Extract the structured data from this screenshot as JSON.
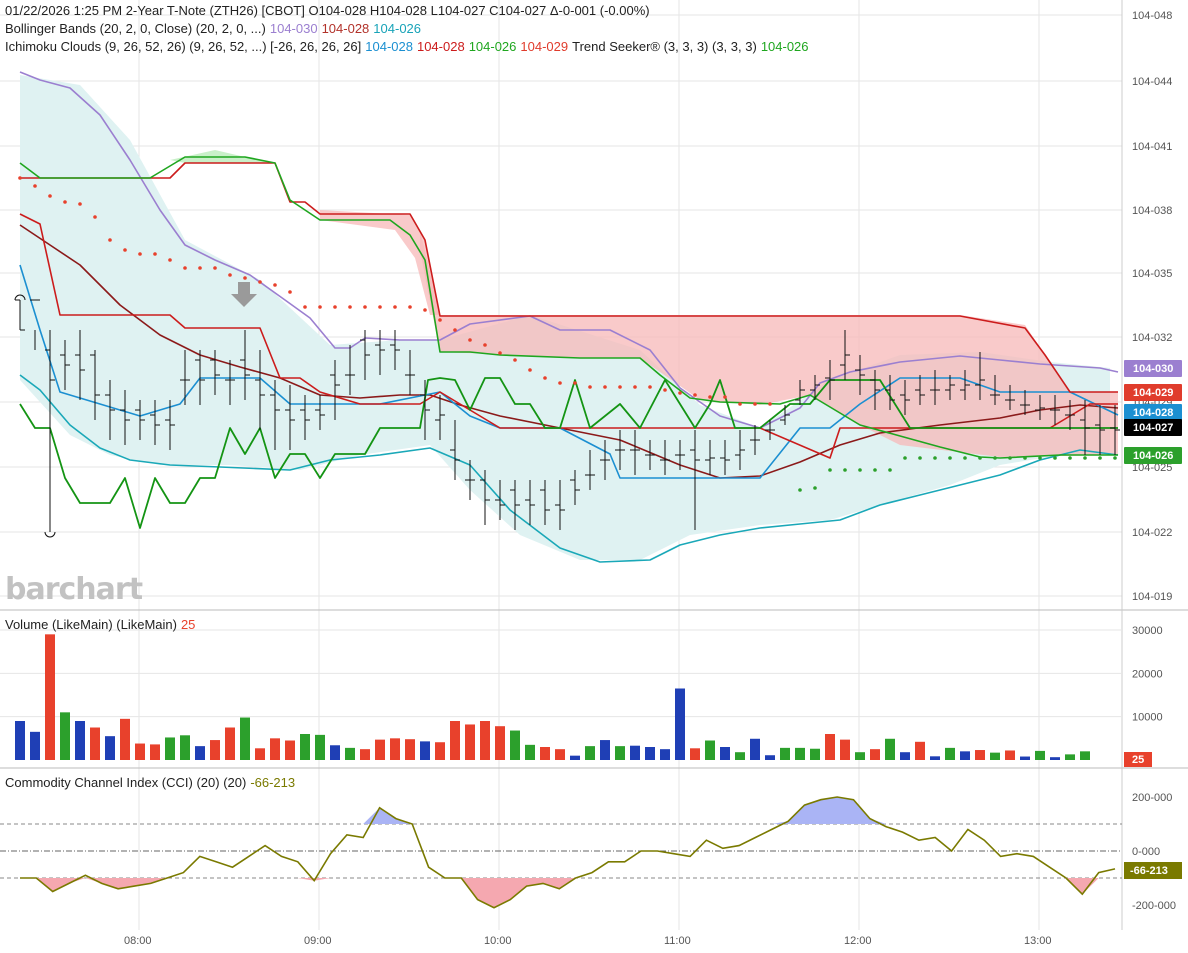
{
  "header": {
    "line1": "01/22/2026  1:25 PM 2-Year T-Note (ZTH26) [CBOT]  O104-028  H104-028  L104-027  C104-027  Δ-0-001  (-0.00%)",
    "bb_label": "Bollinger Bands (20, 2, 0, Close)  (20, 2, 0, ...)",
    "bb_upper": "104-030",
    "bb_mid": "104-028",
    "bb_lower": "104-026",
    "ich_label": "Ichimoku Clouds (9, 26, 52, 26)  (9, 26, 52, ...) [-26, 26, 26, 26]",
    "ich_v1": "104-028",
    "ich_v2": "104-028",
    "ich_v3": "104-026",
    "ich_v4": "104-029",
    "ts_label": "Trend Seeker® (3, 3, 3)  (3, 3, 3)",
    "ts_value": "104-026"
  },
  "volume_header": {
    "label": "Volume (LikeMain)  (LikeMain)",
    "value": "25"
  },
  "cci_header": {
    "label": "Commodity Channel Index (CCI) (20)  (20)",
    "value": "-66-213"
  },
  "watermark": "barchart",
  "colors": {
    "up": "#2ca02c",
    "down": "#e8412c",
    "blue": "#1f3fb5",
    "bb_upper": "#9b7fd0",
    "bb_mid": "#8b1a1a",
    "bb_lower": "#1aa8b8",
    "tenkan": "#1b8fd1",
    "kijun": "#cc1c1c",
    "spanA": "#1fa61f",
    "spanB": "#cc1c1c",
    "trend_dots": "#e8412c",
    "cci": "#7a7a00"
  },
  "chart_data": [
    {
      "type": "line",
      "title": "2-Year T-Note (ZTH26) [CBOT]",
      "y_ticks": [
        "104-048",
        "104-044",
        "104-041",
        "104-038",
        "104-035",
        "104-032",
        "104-029",
        "104-025",
        "104-022",
        "104-019"
      ],
      "x_ticks": [
        "08:00",
        "09:00",
        "10:00",
        "11:00",
        "12:00",
        "13:00"
      ],
      "price_tags": [
        {
          "label": "104-030",
          "color": "#9b7fd0"
        },
        {
          "label": "104-029",
          "color": "#e03c2c"
        },
        {
          "label": "104-028",
          "color": "#1b8fd1"
        },
        {
          "label": "104-027",
          "color": "#000000"
        },
        {
          "label": "104-026",
          "color": "#2ca02c"
        }
      ],
      "series": [
        {
          "name": "Bollinger Upper",
          "values": [
            104.044,
            104.043,
            104.04,
            104.037,
            104.035,
            104.034,
            104.033,
            104.032,
            104.032,
            104.032,
            104.033,
            104.033,
            104.031,
            104.03,
            104.029,
            104.03,
            104.03,
            104.031,
            104.031,
            104.03
          ]
        },
        {
          "name": "Bollinger Middle",
          "values": [
            104.037,
            104.035,
            104.033,
            104.031,
            104.03,
            104.029,
            104.028,
            104.028,
            104.028,
            104.027,
            104.026,
            104.026,
            104.025,
            104.025,
            104.026,
            104.027,
            104.027,
            104.028,
            104.028,
            104.028
          ]
        },
        {
          "name": "Bollinger Lower",
          "values": [
            104.03,
            104.027,
            104.026,
            104.025,
            104.025,
            104.024,
            104.024,
            104.024,
            104.023,
            104.022,
            104.021,
            104.021,
            104.022,
            104.022,
            104.022,
            104.023,
            104.024,
            104.025,
            104.026,
            104.026
          ]
        },
        {
          "name": "Tenkan",
          "values": [
            104.035,
            104.028,
            104.028,
            104.027,
            104.028,
            104.028,
            104.028,
            104.028,
            104.028,
            104.027,
            104.025,
            104.025,
            104.025,
            104.025,
            104.026,
            104.028,
            104.029,
            104.029,
            104.028,
            104.028
          ]
        }
      ]
    },
    {
      "type": "bar",
      "title": "Volume (LikeMain)",
      "y_ticks": [
        "30000",
        "20000",
        "10000"
      ],
      "values": [
        9000,
        6500,
        29000,
        11000,
        9000,
        7500,
        5500,
        9500,
        3800,
        3600,
        5200,
        5700,
        3200,
        4600,
        7500,
        9800,
        2700,
        5000,
        4500,
        6000,
        5800,
        3400,
        2800,
        2500,
        4700,
        5000,
        4800,
        4300,
        4100,
        9000,
        8200,
        9000,
        7800,
        6800,
        3500,
        3000,
        2500,
        1000,
        3200,
        4600,
        3200,
        3300,
        3000,
        2500,
        16500,
        2700,
        4500,
        3000,
        1800,
        4900,
        1100,
        2800,
        2800,
        2600,
        6000,
        4700,
        1800,
        2500,
        4900,
        1800,
        4200,
        850,
        2800,
        2000,
        2300,
        1700,
        2200,
        800,
        2100,
        650,
        1300,
        2000
      ],
      "colors": [
        "b",
        "b",
        "r",
        "g",
        "b",
        "r",
        "b",
        "r",
        "r",
        "r",
        "g",
        "g",
        "b",
        "r",
        "r",
        "g",
        "r",
        "r",
        "r",
        "g",
        "g",
        "b",
        "g",
        "r",
        "r",
        "r",
        "r",
        "b",
        "r",
        "r",
        "r",
        "r",
        "r",
        "g",
        "g",
        "r",
        "r",
        "b",
        "g",
        "b",
        "g",
        "b",
        "b",
        "b",
        "b",
        "r",
        "g",
        "b",
        "g",
        "b",
        "b",
        "g",
        "g",
        "g",
        "r",
        "r",
        "g",
        "r",
        "g",
        "b",
        "r",
        "b",
        "g",
        "b",
        "r",
        "g",
        "r",
        "b",
        "g",
        "b",
        "g",
        "g"
      ]
    },
    {
      "type": "line",
      "title": "Commodity Channel Index (CCI) (20)",
      "y_ticks": [
        "200-000",
        "0-000",
        "-200-000"
      ],
      "series": [
        {
          "name": "CCI",
          "values": [
            -100,
            -100,
            -150,
            -120,
            -90,
            -120,
            -140,
            -130,
            -120,
            -100,
            -80,
            -20,
            -40,
            -60,
            -20,
            20,
            -20,
            -40,
            -110,
            -10,
            60,
            50,
            160,
            120,
            100,
            -60,
            -100,
            -100,
            -180,
            -210,
            -180,
            -130,
            -120,
            -140,
            -100,
            -80,
            -40,
            -40,
            0,
            0,
            -10,
            -20,
            40,
            10,
            20,
            50,
            80,
            110,
            170,
            190,
            200,
            190,
            120,
            90,
            70,
            40,
            50,
            0,
            80,
            40,
            -20,
            -10,
            -20,
            -60,
            -100,
            -160,
            -80,
            -66.213
          ]
        }
      ]
    }
  ]
}
